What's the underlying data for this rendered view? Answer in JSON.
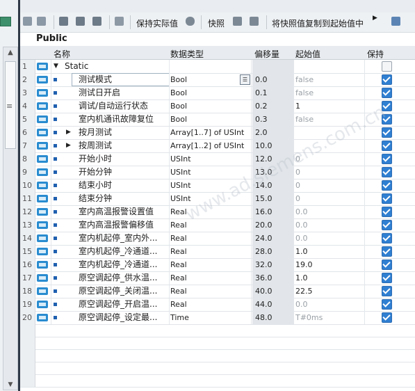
{
  "toolbar": {
    "keep_actual": "保持实际值",
    "snapshot": "快照",
    "copy_snapshot": "将快照值复制到起始值中"
  },
  "section": {
    "title": "Public"
  },
  "columns": {
    "name": "名称",
    "type": "数据类型",
    "offset": "偏移量",
    "start": "起始值",
    "retain": "保持"
  },
  "watermark": "www.ad.siemens.com.cn",
  "rows": [
    {
      "no": "1",
      "name": "Static",
      "type": "",
      "offset": "",
      "start": "",
      "retain": false,
      "level": 0,
      "expander": "▼"
    },
    {
      "no": "2",
      "name": "测试模式",
      "type": "Bool",
      "offset": "0.0",
      "start": "false",
      "retain": true,
      "level": 1
    },
    {
      "no": "3",
      "name": "测试日开启",
      "type": "Bool",
      "offset": "0.1",
      "start": "false",
      "retain": true,
      "level": 1
    },
    {
      "no": "4",
      "name": "调试/自动运行状态",
      "type": "Bool",
      "offset": "0.2",
      "start": "1",
      "retain": true,
      "level": 1
    },
    {
      "no": "5",
      "name": "室内机通讯故障复位",
      "type": "Bool",
      "offset": "0.3",
      "start": "false",
      "retain": true,
      "level": 1
    },
    {
      "no": "6",
      "name": "按月测试",
      "type": "Array[1..7] of USInt",
      "offset": "2.0",
      "start": "",
      "retain": true,
      "level": 1,
      "expander": "▶"
    },
    {
      "no": "7",
      "name": "按周测试",
      "type": "Array[1..2] of USInt",
      "offset": "10.0",
      "start": "",
      "retain": true,
      "level": 1,
      "expander": "▶"
    },
    {
      "no": "8",
      "name": "开始小时",
      "type": "USInt",
      "offset": "12.0",
      "start": "0",
      "retain": true,
      "level": 1
    },
    {
      "no": "9",
      "name": "开始分钟",
      "type": "USInt",
      "offset": "13.0",
      "start": "0",
      "retain": true,
      "level": 1
    },
    {
      "no": "10",
      "name": "结束小时",
      "type": "USInt",
      "offset": "14.0",
      "start": "0",
      "retain": true,
      "level": 1
    },
    {
      "no": "11",
      "name": "结束分钟",
      "type": "USInt",
      "offset": "15.0",
      "start": "0",
      "retain": true,
      "level": 1
    },
    {
      "no": "12",
      "name": "室内高温报警设置值",
      "type": "Real",
      "offset": "16.0",
      "start": "0.0",
      "retain": true,
      "level": 1
    },
    {
      "no": "13",
      "name": "室内高温报警偏移值",
      "type": "Real",
      "offset": "20.0",
      "start": "0.0",
      "retain": true,
      "level": 1
    },
    {
      "no": "14",
      "name": "室内机起停_室内外...",
      "type": "Real",
      "offset": "24.0",
      "start": "0.0",
      "retain": true,
      "level": 1
    },
    {
      "no": "15",
      "name": "室内机起停_冷通道...",
      "type": "Real",
      "offset": "28.0",
      "start": "1.0",
      "retain": true,
      "level": 1
    },
    {
      "no": "16",
      "name": "室内机起停_冷通道...",
      "type": "Real",
      "offset": "32.0",
      "start": "19.0",
      "retain": true,
      "level": 1
    },
    {
      "no": "17",
      "name": "原空调起停_供水温...",
      "type": "Real",
      "offset": "36.0",
      "start": "1.0",
      "retain": true,
      "level": 1
    },
    {
      "no": "18",
      "name": "原空调起停_关闭温...",
      "type": "Real",
      "offset": "40.0",
      "start": "22.5",
      "retain": true,
      "level": 1
    },
    {
      "no": "19",
      "name": "原空调起停_开启温...",
      "type": "Real",
      "offset": "44.0",
      "start": "0.0",
      "retain": true,
      "level": 1
    },
    {
      "no": "20",
      "name": "原空调起停_设定最...",
      "type": "Time",
      "offset": "48.0",
      "start": "T#0ms",
      "retain": true,
      "level": 1
    }
  ],
  "colors": {
    "accent": "#2f7fd2",
    "divider": "#2f3947",
    "header_bg": "#e8ecf0"
  },
  "icons": [
    "add-row-icon",
    "insert-row-icon",
    "keep-actual-icon",
    "snapshot-icon",
    "copy-snapshot-icon",
    "expand-icon",
    "checkbox-icon"
  ]
}
